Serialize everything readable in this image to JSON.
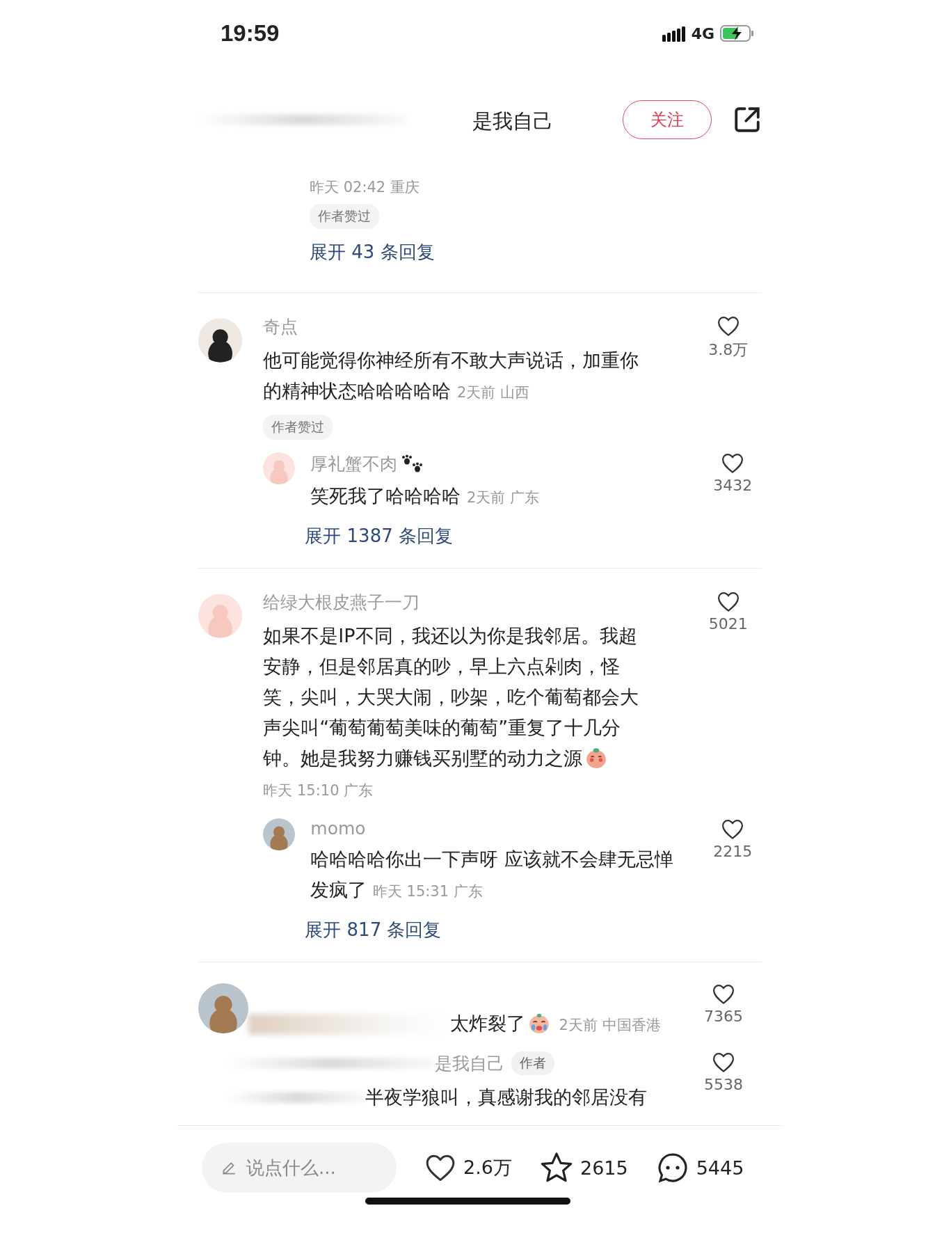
{
  "status_bar": {
    "time": "19:59",
    "network": "4G"
  },
  "header": {
    "title": "是我自己",
    "follow_button": "关注"
  },
  "comments": [
    {
      "kind": "tail",
      "meta": "昨天 02:42 重庆",
      "tag": "作者赞过",
      "expand": "展开 43 条回复"
    },
    {
      "kind": "full",
      "name": "奇点",
      "text": "他可能觉得你神经所有不敢大声说话，加重你的精神状态哈哈哈哈哈",
      "meta": "2天前 山西",
      "likes": "3.8万",
      "tag": "作者赞过",
      "reply": {
        "name": "厚礼蟹不肉",
        "name_icon": {
          "kind": "paw"
        },
        "text": "笑死我了哈哈哈哈",
        "meta": "2天前 广东",
        "likes": "3432"
      },
      "expand": "展开 1387 条回复"
    },
    {
      "kind": "full",
      "name": "给绿大根皮燕子一刀",
      "text": "如果不是IP不同，我还以为你是我邻居。我超安静，但是邻居真的吵，早上六点剁肉，怪笑，尖叫，大哭大闹，吵架，吃个葡萄都会大声尖叫“葡萄葡萄美味的葡萄”重复了十几分钟。她是我努力赚钱买别墅的动力之源",
      "emoji": {
        "kind": "blush"
      },
      "meta": "昨天 15:10 广东",
      "likes": "5021",
      "reply": {
        "name": "momo",
        "text": "哈哈哈哈你出一下声呀 应该就不会肆无忌惮发疯了",
        "meta": "昨天 15:31 广东",
        "likes": "2215"
      },
      "expand": "展开 817 条回复"
    },
    {
      "kind": "blurred",
      "text": "太炸裂了",
      "emoji": {
        "kind": "crying"
      },
      "meta": "2天前 中国香港",
      "likes": "7365",
      "reply": {
        "name": "是我自己",
        "role_tag": "作者",
        "text": "半夜学狼叫，真感谢我的邻居没有",
        "likes": "5538"
      }
    }
  ],
  "bottom_bar": {
    "placeholder": "说点什么...",
    "likes": "2.6万",
    "favorites": "2615",
    "comments": "5445"
  }
}
